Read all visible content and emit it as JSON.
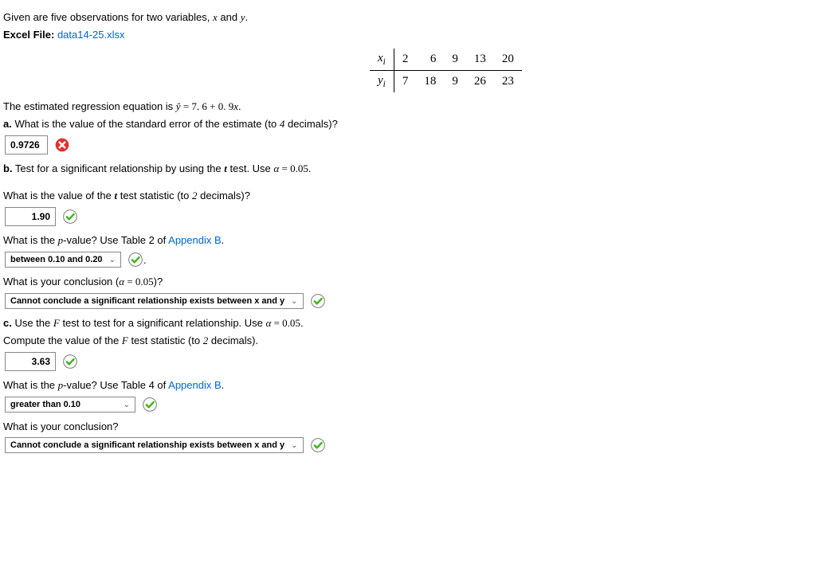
{
  "intro": {
    "given": "Given are five observations for two variables,",
    "vars": "x and y.",
    "excel_label": "Excel File:",
    "excel_file": "data14-25.xlsx"
  },
  "table": {
    "row1_label": "xᵢ",
    "row2_label": "yᵢ",
    "x": [
      "2",
      "6",
      "9",
      "13",
      "20"
    ],
    "y": [
      "7",
      "18",
      "9",
      "26",
      "23"
    ]
  },
  "regression_text": "The estimated regression equation is ",
  "regression_eq": "ŷ = 7.6 + 0.9x.",
  "a": {
    "prompt": "a. What is the value of the standard error of the estimate (to 4 decimals)?",
    "answer": "0.9726"
  },
  "b": {
    "prompt_pre": "b. Test for a significant relationship by using the ",
    "prompt_mid": " test. Use ",
    "alpha": "α = 0.05.",
    "q_tstat": "What is the value of the t test statistic (to 2 decimals)?",
    "t_answer": "1.90",
    "q_pval_pre": "What is the p-value? Use Table 2 of ",
    "appendix": "Appendix B",
    "p_answer": "between 0.10 and 0.20",
    "q_concl": "What is your conclusion (α = 0.05)?",
    "concl_answer": "Cannot conclude a significant relationship exists between x and y"
  },
  "c": {
    "prompt_pre": "c. Use the ",
    "prompt_mid": " test to test for a significant relationship. Use ",
    "alpha": "α = 0.05.",
    "q_fstat": "Compute the value of the F test statistic (to 2 decimals).",
    "f_answer": "3.63",
    "q_pval_pre": "What is the p-value? Use Table 4 of ",
    "appendix": "Appendix B",
    "p_answer": "greater than 0.10",
    "q_concl": "What is your conclusion?",
    "concl_answer": "Cannot conclude a significant relationship exists between x and y"
  },
  "period": "."
}
